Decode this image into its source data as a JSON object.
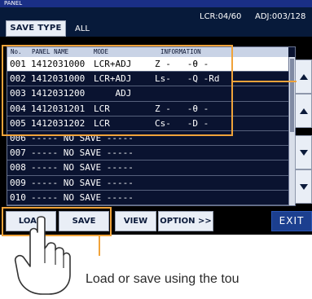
{
  "header": {
    "title": "PANEL",
    "save_type_label": "SAVE TYPE",
    "save_type_value": "ALL",
    "lcr_count": "LCR:04/60",
    "adj_count": "ADJ:003/128"
  },
  "table": {
    "columns": [
      "No.",
      "PANEL NAME",
      "MODE",
      "INFORMATION"
    ],
    "rows": [
      {
        "no": "001",
        "name": "1412031000",
        "mode": "LCR+ADJ",
        "info": "Z -   -θ -"
      },
      {
        "no": "002",
        "name": "1412031000",
        "mode": "LCR+ADJ",
        "info": "Ls-   -Q -Rd"
      },
      {
        "no": "003",
        "name": "1412031200",
        "mode": "    ADJ",
        "info": ""
      },
      {
        "no": "004",
        "name": "1412031201",
        "mode": "LCR",
        "info": "Z -   -θ -"
      },
      {
        "no": "005",
        "name": "1412031202",
        "mode": "LCR",
        "info": "Cs-   -D -"
      },
      {
        "no": "006",
        "name": "----- NO SAVE -----",
        "mode": "",
        "info": ""
      },
      {
        "no": "007",
        "name": "----- NO SAVE -----",
        "mode": "",
        "info": ""
      },
      {
        "no": "008",
        "name": "----- NO SAVE -----",
        "mode": "",
        "info": ""
      },
      {
        "no": "009",
        "name": "----- NO SAVE -----",
        "mode": "",
        "info": ""
      },
      {
        "no": "010",
        "name": "----- NO SAVE -----",
        "mode": "",
        "info": ""
      }
    ],
    "selected_row": 0
  },
  "buttons": {
    "load": "LOAD",
    "save": "SAVE",
    "view": "VIEW",
    "option": "OPTION >>",
    "exit": "EXIT"
  },
  "caption": "Load or save using the tou",
  "colors": {
    "highlight": "#f0a33a",
    "exit": "#1c3f8f",
    "screen_bg": "#000000"
  }
}
